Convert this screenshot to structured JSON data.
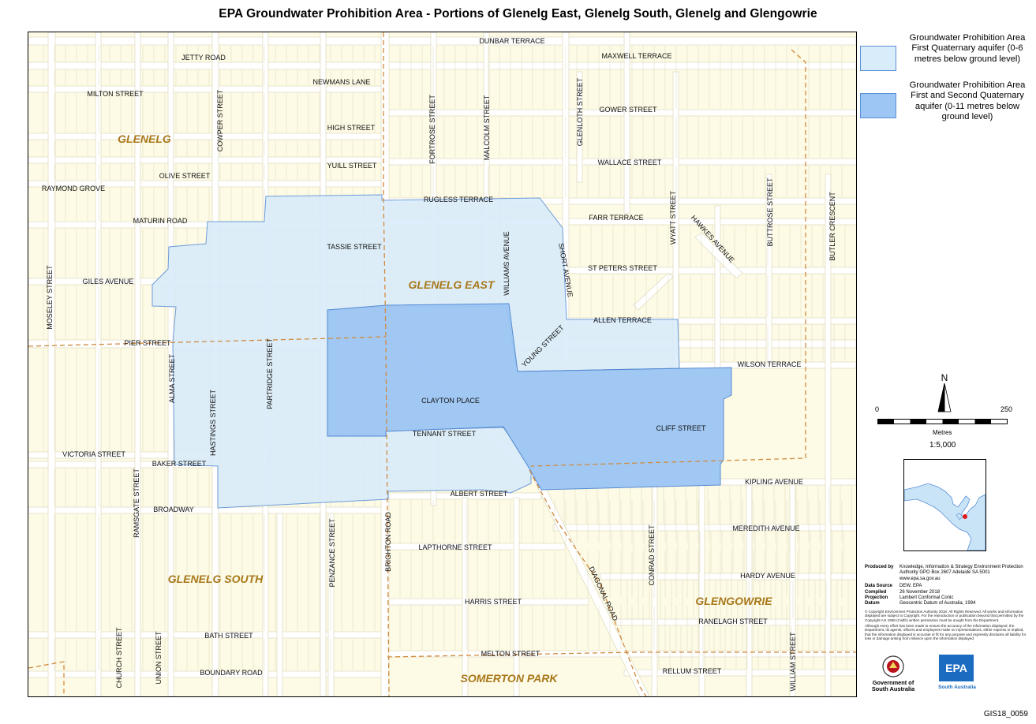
{
  "title": "EPA Groundwater Prohibition Area - Portions of Glenelg East, Glenelg South, Glenelg and Glengowrie",
  "colors": {
    "land": "#fdfbe6",
    "road": "#ffffff",
    "parcel_line": "#e2ddc2",
    "suburb_boundary": "#d08a3e",
    "zone_first": "#d9ecfa",
    "zone_first_second": "#9dc6f4",
    "zone_outline": "#5a8fd6",
    "suburb_text": "#a8781a"
  },
  "legend": {
    "items": [
      {
        "label": "Groundwater Prohibition Area First Quaternary aquifer (0-6 metres below ground level)",
        "color": "#d9ecfa"
      },
      {
        "label": "Groundwater Prohibition Area First and Second Quaternary aquifer (0-11 metres below ground level)",
        "color": "#9dc6f4"
      }
    ]
  },
  "north_label": "N",
  "scale": {
    "min": "0",
    "max": "250",
    "unit": "Metres",
    "ratio": "1:5,000"
  },
  "suburbs": [
    "GLENELG",
    "GLENELG EAST",
    "GLENELG SOUTH",
    "GLENGOWRIE",
    "SOMERTON PARK"
  ],
  "roads": [
    "DUNBAR TERRACE",
    "JETTY ROAD",
    "MAXWELL TERRACE",
    "NEWMANS LANE",
    "MILTON STREET",
    "COWPER STREET",
    "FORTROSE STREET",
    "MALCOLM STREET",
    "GLENLOTH STREET",
    "GOWER STREET",
    "HIGH STREET",
    "YUILL STREET",
    "WALLACE STREET",
    "OLIVE STREET",
    "RAYMOND GROVE",
    "RUGLESS TERRACE",
    "WYATT STREET",
    "BUTTROSE STREET",
    "BUTLER CRESCENT",
    "MATURIN ROAD",
    "FARR TERRACE",
    "HAWKES AVENUE",
    "TASSIE STREET",
    "WILLIAMS AVENUE",
    "SHORT AVENUE",
    "ST PETERS STREET",
    "GILES AVENUE",
    "MOSELEY STREET",
    "ALLEN TERRACE",
    "YOUNG STREET",
    "PIER STREET",
    "WILSON TERRACE",
    "ALMA STREET",
    "PARTRIDGE STREET",
    "HASTINGS STREET",
    "CLAYTON PLACE",
    "CLIFF STREET",
    "TENNANT STREET",
    "VICTORIA STREET",
    "BAKER STREET",
    "RAMSGATE STREET",
    "KIPLING AVENUE",
    "ALBERT STREET",
    "BROADWAY",
    "BRIGHTON ROAD",
    "PENZANCE STREET",
    "MEREDITH AVENUE",
    "CONRAD STREET",
    "LAPTHORNE STREET",
    "DIAGONAL ROAD",
    "HARDY AVENUE",
    "HARRIS STREET",
    "RANELAGH STREET",
    "BATH STREET",
    "CHURCH STREET",
    "UNION STREET",
    "MELTON STREET",
    "WILLIAM STREET",
    "BOUNDARY ROAD",
    "RELLUM STREET"
  ],
  "metadata": {
    "produced_by_label": "Produced by",
    "produced_by": "Knowledge, Information & Strategy Environment Protection Authority GPO Box 2607 Adelaide SA 5001 www.epa.sa.gov.au",
    "data_source_label": "Data Source",
    "data_source": "DEW, EPA",
    "compiled_label": "Compiled",
    "compiled": "26 November 2018",
    "projection_label": "Projection",
    "projection": "Lambert Conformal Conic",
    "datum_label": "Datum",
    "datum": "Geocentric Datum of Australia, 1994",
    "copyright": "© Copyright Environment Protection Authority 2018. All Rights Reserved. All works and information displayed are subject to Copyright. For the reproduction or publication beyond that permitted by the Copyright Act 1968 (Cwlth) written permission must be sought from the Department.",
    "disclaimer": "Although every effort has been made to ensure the accuracy of the information displayed, the Department, its agents, officers and employees make no representations, either express or implied, that the information displayed is accurate or fit for any purpose and expressly disclaims all liability for loss or damage arising from reliance upon the information displayed."
  },
  "logos": {
    "government": "Government of South Australia",
    "epa": "EPA",
    "epa_sub": "South Australia"
  },
  "map_code": "GIS18_0059"
}
